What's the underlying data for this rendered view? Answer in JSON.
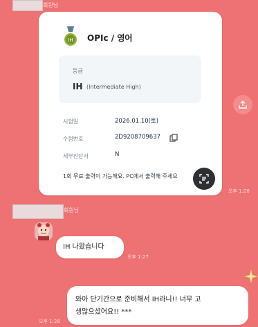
{
  "chat": {
    "sender_top": "회원님",
    "sender_mid": "회원님"
  },
  "card": {
    "title": "OPIc / 영어",
    "grade_label": "등급",
    "grade_code": "IH",
    "grade_desc": "(Intermediate High)",
    "rows": [
      {
        "label": "시험일",
        "value": "2026.01.10(토)"
      },
      {
        "label": "수험번호",
        "value": "2D9208709637"
      },
      {
        "label": "세부진단서",
        "value": "N"
      }
    ],
    "notice": "1회 무료 출력이 가능해요. PC에서 출력해 주세요"
  },
  "times": {
    "card": "오후 1:26",
    "msg1": "오후 1:27",
    "msg2": "오후 1:28"
  },
  "messages": {
    "m1": "IH 나왔습니다",
    "m2_line1": "와아 단기간으로 준비해서 IH라니!! 너무 고",
    "m2_line2": "생많으셨어요!! ***"
  },
  "icons": {
    "medal": "medal-icon",
    "copy": "copy-icon",
    "scan": "scan-icon",
    "share": "share-icon"
  },
  "colors": {
    "background": "#ee7173",
    "card": "#ffffff",
    "bubble": "#ffffff"
  }
}
